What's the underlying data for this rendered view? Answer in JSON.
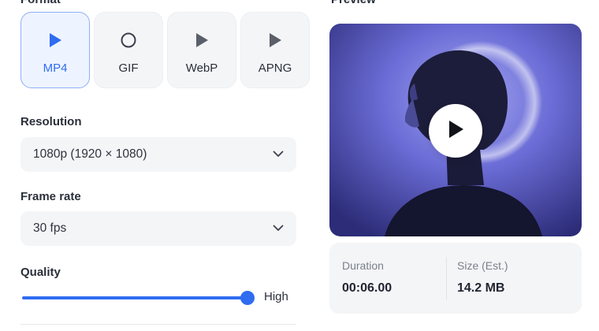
{
  "format": {
    "label": "Format",
    "options": [
      {
        "label": "MP4",
        "icon": "play-icon",
        "selected": true
      },
      {
        "label": "GIF",
        "icon": "circle-icon",
        "selected": false
      },
      {
        "label": "WebP",
        "icon": "play-icon",
        "selected": false
      },
      {
        "label": "APNG",
        "icon": "play-icon",
        "selected": false
      }
    ]
  },
  "resolution": {
    "label": "Resolution",
    "value": "1080p (1920 × 1080)"
  },
  "frame_rate": {
    "label": "Frame rate",
    "value": "30 fps"
  },
  "quality": {
    "label": "Quality",
    "value_label": "High",
    "level": 1.0
  },
  "preview": {
    "label": "Preview"
  },
  "info": {
    "duration_label": "Duration",
    "duration_value": "00:06.00",
    "size_label": "Size (Est.)",
    "size_value": "14.2 MB"
  },
  "colors": {
    "accent": "#2f6cf0",
    "card_bg": "#f4f5f7",
    "selected_bg": "#eef4ff"
  }
}
